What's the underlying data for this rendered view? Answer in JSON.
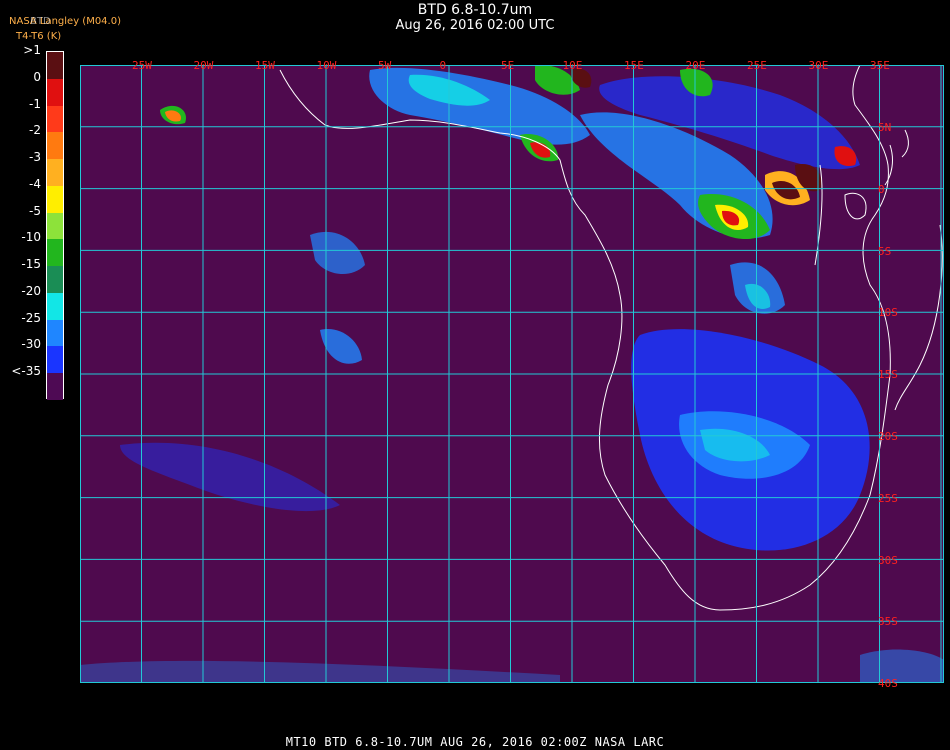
{
  "header": {
    "title": "BTD 6.8-10.7um",
    "subtitle": "Aug 26, 2016 02:00 UTC",
    "source": "NASA Langley (M04.0)",
    "variable": "BTD",
    "units": "T4-T6 (K)"
  },
  "legend": {
    "labels": [
      ">1",
      "0",
      "-1",
      "-2",
      "-3",
      "-4",
      "-5",
      "-10",
      "-15",
      "-20",
      "-25",
      "-30",
      "<-35"
    ],
    "colors": [
      "#5a0f12",
      "#e01010",
      "#ff3a1a",
      "#ff7a10",
      "#ffb020",
      "#ffee00",
      "#8de23a",
      "#22b61e",
      "#1a8d55",
      "#12e6e6",
      "#1f86ff",
      "#1a35ff",
      "#4e0a54"
    ]
  },
  "map": {
    "background": "#4f0a4e",
    "grid_color": "#22c9d6",
    "top_lon_labels": [
      "25W",
      "20W",
      "15W",
      "10W",
      "5W",
      "0",
      "5E",
      "10E",
      "15E",
      "20E",
      "25E",
      "30E",
      "35E"
    ],
    "right_lat_labels": [
      "5N",
      "0",
      "5S",
      "10S",
      "15S",
      "20S",
      "25S",
      "30S",
      "35S",
      "40S"
    ]
  },
  "footer": "MT10  BTD 6.8-10.7UM   AUG 26, 2016 02:00Z   NASA LARC"
}
